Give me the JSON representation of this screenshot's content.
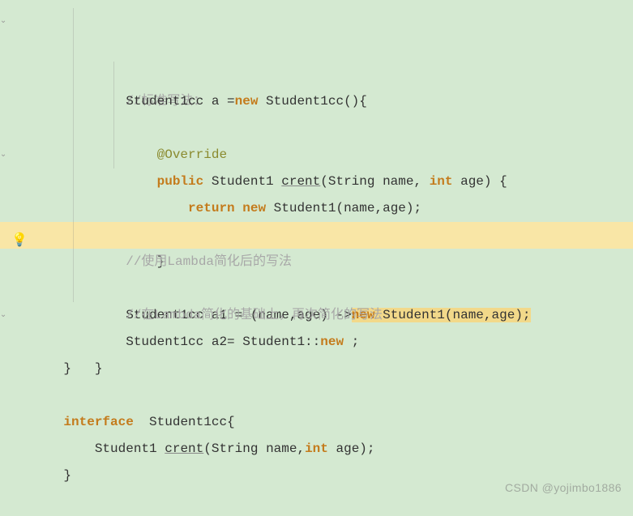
{
  "code": {
    "comment1": "//标准写法：",
    "line_anon_decl_1": "Student1cc a =",
    "kw_new1": "new",
    "line_anon_decl_2": " Student1cc(){",
    "annotation_override": "@Override",
    "kw_public": "public",
    "ret_type": " Student1 ",
    "method_name": "crent",
    "method_params": "(String name, ",
    "kw_int1": "int",
    "method_params2": " age) {",
    "kw_return": "return",
    "space1": " ",
    "kw_new2": "new",
    "return_rest": " Student1(name,age);",
    "close_brace1": "}",
    "close_anon": "};",
    "comment2": "//使用Lambda简化后的写法",
    "lambda_decl": "Student1cc a1 = (name,age) ->",
    "kw_new3": "new",
    "lambda_rest": " Student1(name,age);",
    "comment3": "//在Lambda简化的基础上，再次简化的写法",
    "mref_decl": "Student1cc a2= Student1::",
    "kw_new4": "new",
    "mref_end": " ;",
    "close_brace_outer": "}",
    "close_brace_class": "}",
    "empty": "",
    "kw_interface": "interface",
    "interface_name": "  Student1cc{",
    "iface_method_1": "    Student1 ",
    "iface_method_name": "crent",
    "iface_method_2": "(String name,",
    "kw_int2": "int",
    "iface_method_3": " age);",
    "close_interface": "}"
  },
  "watermark": "CSDN @yojimbo1886",
  "icons": {
    "bulb": "💡"
  }
}
